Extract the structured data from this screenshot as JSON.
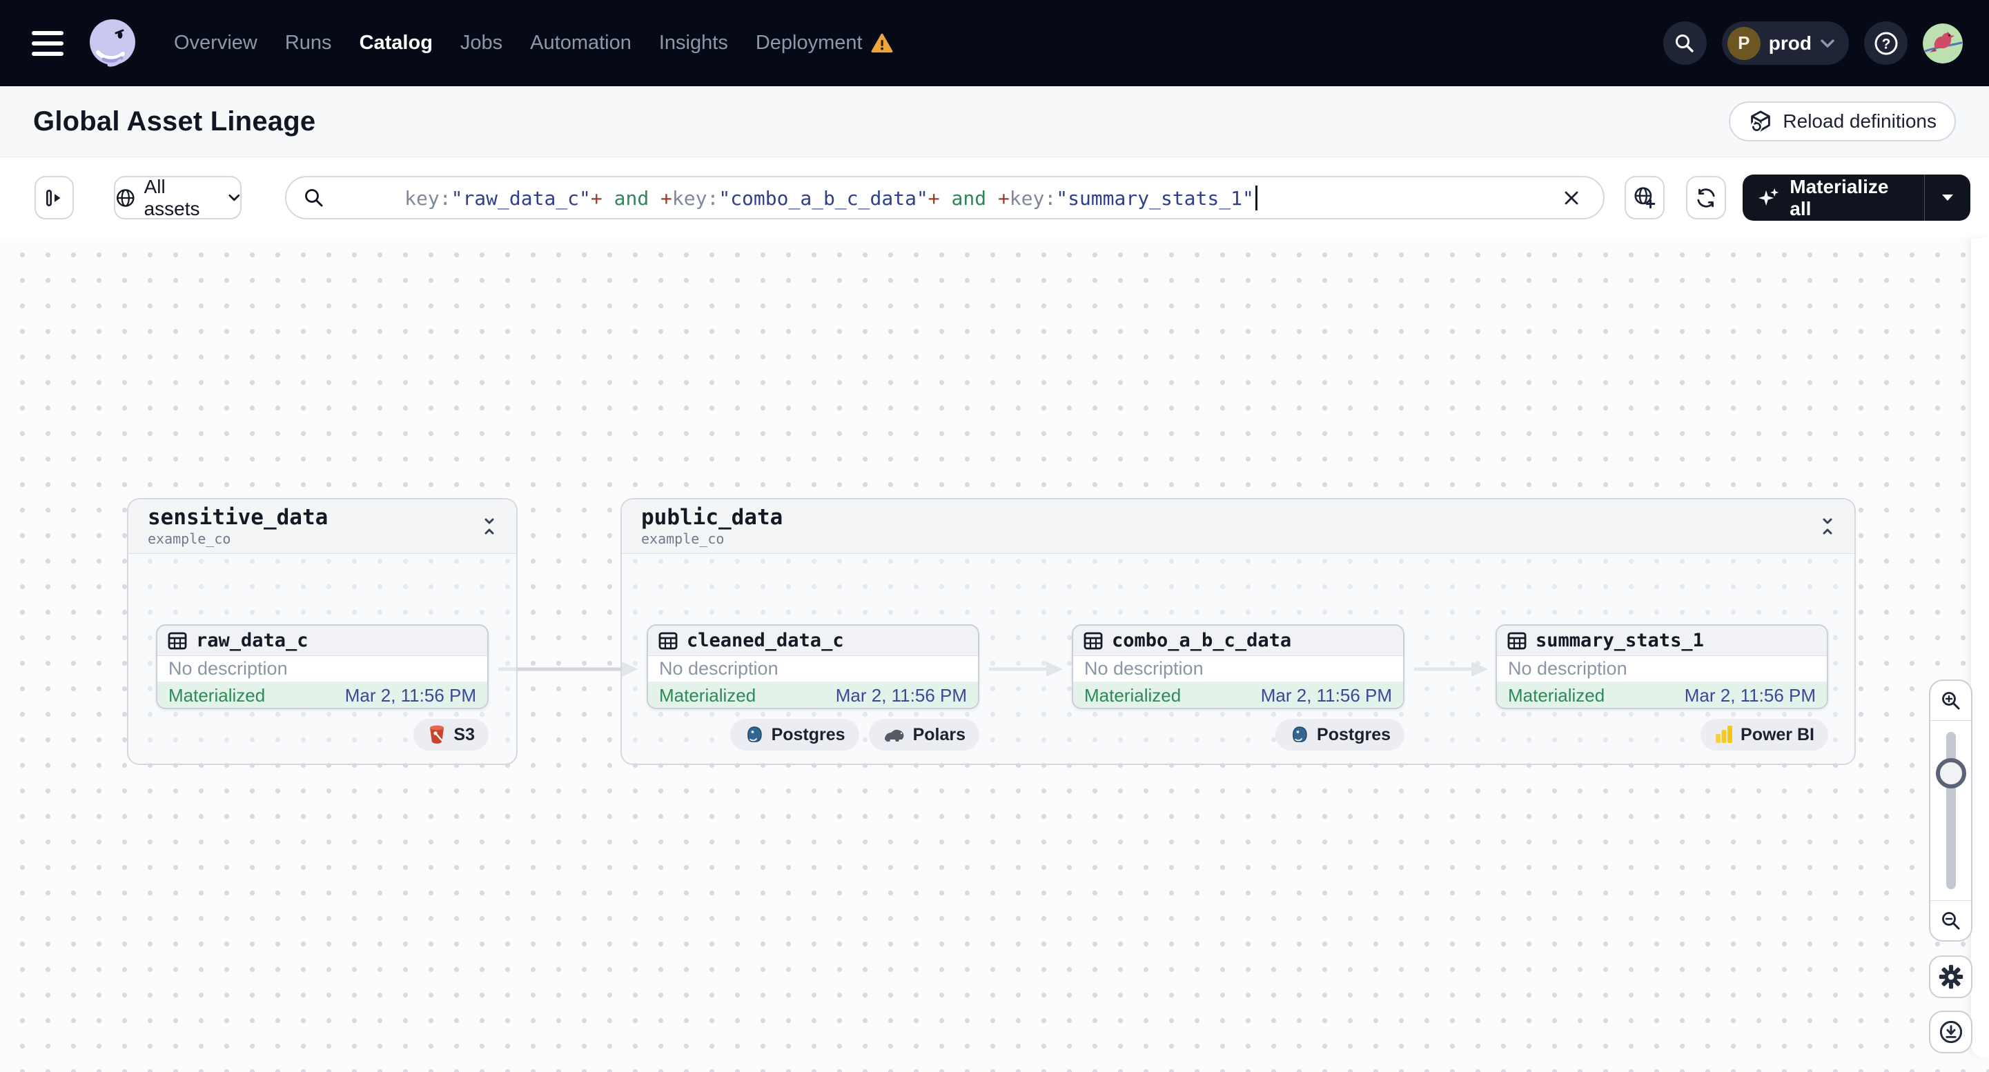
{
  "nav": {
    "items": [
      {
        "label": "Overview"
      },
      {
        "label": "Runs"
      },
      {
        "label": "Catalog",
        "active": true
      },
      {
        "label": "Jobs"
      },
      {
        "label": "Automation"
      },
      {
        "label": "Insights"
      },
      {
        "label": "Deployment",
        "warning": true
      }
    ],
    "env": {
      "initial": "P",
      "label": "prod"
    }
  },
  "header": {
    "title": "Global Asset Lineage",
    "reload_button": "Reload definitions"
  },
  "toolbar": {
    "scope_label": "All assets",
    "materialize_label": "Materialize all",
    "query_tokens": [
      {
        "text": "key:",
        "color": "#7F8899"
      },
      {
        "text": "\"raw_data_c\"",
        "color": "#2F3E8E"
      },
      {
        "text": "+",
        "color": "#9A3A2C"
      },
      {
        "text": " and ",
        "color": "#2E8659"
      },
      {
        "text": "+",
        "color": "#9A3A2C"
      },
      {
        "text": "key:",
        "color": "#7F8899"
      },
      {
        "text": "\"combo_a_b_c_data\"",
        "color": "#2F3E8E"
      },
      {
        "text": "+",
        "color": "#9A3A2C"
      },
      {
        "text": " and ",
        "color": "#2E8659"
      },
      {
        "text": "+",
        "color": "#9A3A2C"
      },
      {
        "text": "key:",
        "color": "#7F8899"
      },
      {
        "text": "\"summary_stats_1\"",
        "color": "#2F3E8E"
      }
    ]
  },
  "graph": {
    "groups": [
      {
        "name": "sensitive_data",
        "location": "example_co"
      },
      {
        "name": "public_data",
        "location": "example_co"
      }
    ],
    "nodes": [
      {
        "name": "raw_data_c",
        "description": "No description",
        "status": "Materialized",
        "timestamp": "Mar 2, 11:56 PM",
        "badges": [
          {
            "label": "S3"
          }
        ]
      },
      {
        "name": "cleaned_data_c",
        "description": "No description",
        "status": "Materialized",
        "timestamp": "Mar 2, 11:56 PM",
        "badges": [
          {
            "label": "Postgres"
          },
          {
            "label": "Polars"
          }
        ]
      },
      {
        "name": "combo_a_b_c_data",
        "description": "No description",
        "status": "Materialized",
        "timestamp": "Mar 2, 11:56 PM",
        "badges": [
          {
            "label": "Postgres"
          }
        ]
      },
      {
        "name": "summary_stats_1",
        "description": "No description",
        "status": "Materialized",
        "timestamp": "Mar 2, 11:56 PM",
        "badges": [
          {
            "label": "Power BI"
          }
        ]
      }
    ]
  },
  "colors": {
    "navbar_bg": "#060A16",
    "accent_warning": "#F0A43E",
    "status_materialized_bg": "#E3F3E9",
    "status_materialized_text": "#2B8A57",
    "timestamp_text": "#3A479B",
    "materialize_button_bg": "#10141F"
  }
}
